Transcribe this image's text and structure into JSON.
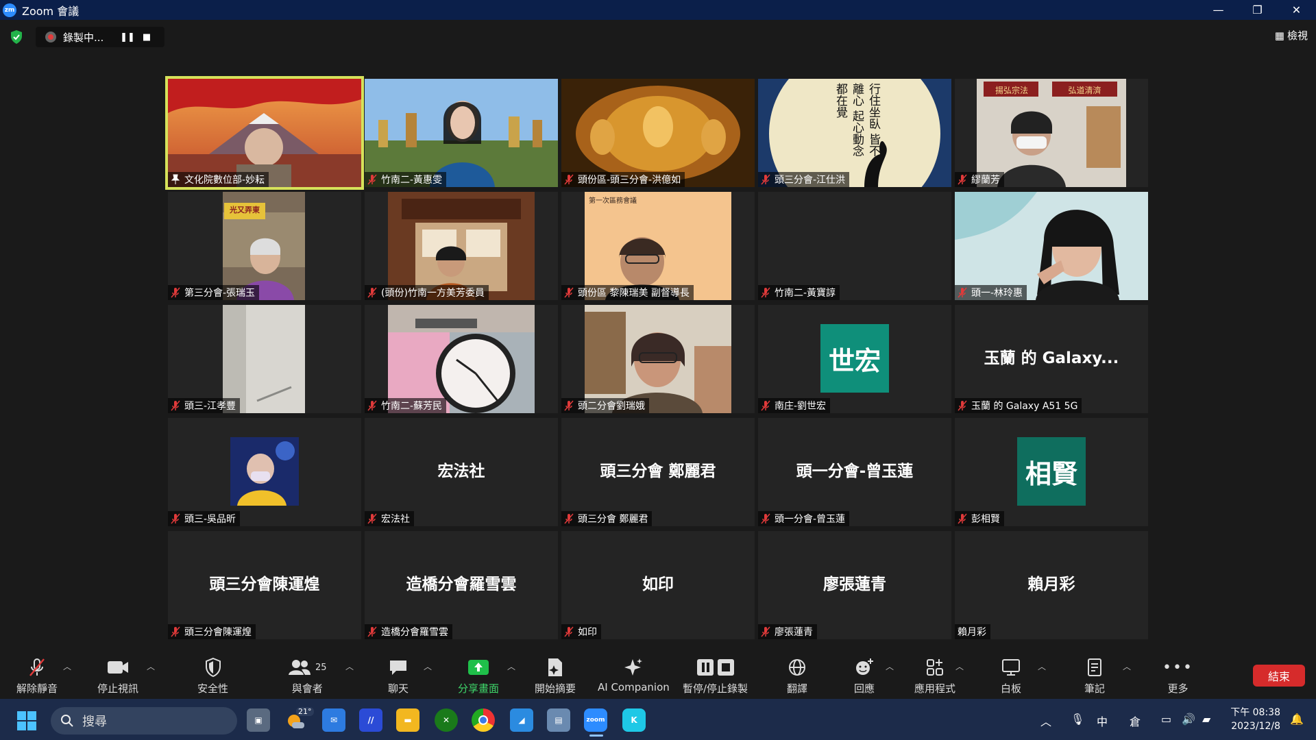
{
  "window": {
    "title": "Zoom 會議",
    "logo": "zm"
  },
  "top": {
    "recording_label": "錄製中...",
    "view_label": "檢視"
  },
  "tiles": [
    {
      "name": "文化院數位部-妙耘",
      "center": ""
    },
    {
      "name": "竹南二-黃惠雯",
      "center": ""
    },
    {
      "name": "頭份區-頭三分會-洪億如",
      "center": ""
    },
    {
      "name": "頭三分會-江仕洪",
      "center": ""
    },
    {
      "name": "繆蘭芳",
      "center": ""
    },
    {
      "name": "第三分會-張瑞玉",
      "center": ""
    },
    {
      "name": "(頭份)竹南一方美芳委員",
      "center": ""
    },
    {
      "name": "頭份區 黎陳瑞美 副督導長",
      "center": ""
    },
    {
      "name": "竹南二-黃寶諄",
      "center": ""
    },
    {
      "name": "頭一-林玲惠",
      "center": ""
    },
    {
      "name": "頭三-江孝豐",
      "center": ""
    },
    {
      "name": "竹南二-蘇芳民",
      "center": ""
    },
    {
      "name": "頭二分會劉瑞娥",
      "center": ""
    },
    {
      "name": "南庄-劉世宏",
      "center": "世宏"
    },
    {
      "name": "玉蘭 的 Galaxy A51 5G",
      "center": "玉蘭 的 Galaxy..."
    },
    {
      "name": "頭三-吳品昕",
      "center": ""
    },
    {
      "name": "宏法社",
      "center": "宏法社"
    },
    {
      "name": "頭三分會 鄭麗君",
      "center": "頭三分會 鄭麗君"
    },
    {
      "name": "頭一分會-曾玉蓮",
      "center": "頭一分會-曾玉蓮"
    },
    {
      "name": "彭相賢",
      "center": "相賢"
    },
    {
      "name": "頭三分會陳運煌",
      "center": "頭三分會陳運煌"
    },
    {
      "name": "造橋分會羅雪雲",
      "center": "造橋分會羅雪雲"
    },
    {
      "name": "如印",
      "center": "如印"
    },
    {
      "name": "廖張蓮青",
      "center": "廖張蓮青"
    },
    {
      "name": "賴月彩",
      "center": "賴月彩"
    }
  ],
  "tile_texts": {
    "banner_left": "光又弄東",
    "banner_right_1": "揚弘宗法",
    "banner_right_2": "弘道清濟",
    "doc_header": "第一次區務會議",
    "poem": "行住坐臥 皆不離心 起心動念 都在覺"
  },
  "toolbar": {
    "unmute": "解除靜音",
    "stop_video": "停止視訊",
    "security": "安全性",
    "participants": "與會者",
    "participants_count": "25",
    "chat": "聊天",
    "share": "分享畫面",
    "summary": "開始摘要",
    "ai": "AI Companion",
    "pause_rec": "暫停/停止錄製",
    "translate": "翻譯",
    "reactions": "回應",
    "apps": "應用程式",
    "whiteboard": "白板",
    "notes": "筆記",
    "more": "更多",
    "end": "結束"
  },
  "taskbar": {
    "search": "搜尋",
    "weather": "21°",
    "ime": "中",
    "ime2": "倉",
    "time": "下午 08:38",
    "date": "2023/12/8"
  },
  "colors": {
    "active_border": "#d6e25a",
    "avatar_teal": "#0f8f7a",
    "end_red": "#d62b2b",
    "share_green": "#1fbf4a"
  }
}
